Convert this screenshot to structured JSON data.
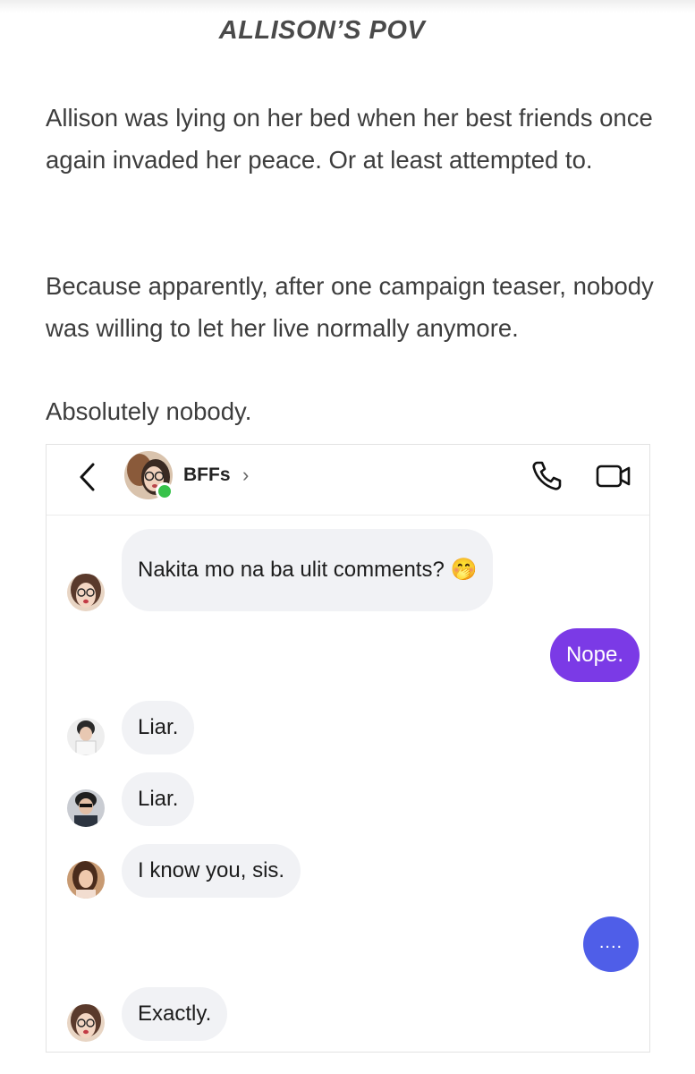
{
  "story": {
    "chapter_title": "ALLISON’S POV",
    "paragraph_1": "Allison was lying on her bed when her best friends once again invaded her peace. Or at least attempted to.",
    "paragraph_2": "Because apparently, after one campaign teaser, nobody was willing to let her live normally anymore.",
    "paragraph_3": "Absolutely nobody."
  },
  "chat": {
    "header": {
      "group_name": "BFFs",
      "chevron": "›",
      "back_icon": "chevron-left-icon",
      "call_icon": "phone-icon",
      "video_icon": "video-camera-icon",
      "online_color": "#37c24a"
    },
    "messages": [
      {
        "sender": "friend",
        "text": "Nakita mo na ba ulit comments? 🤭"
      },
      {
        "sender": "me",
        "text": "Nope."
      },
      {
        "sender": "friend",
        "text": "Liar."
      },
      {
        "sender": "friend",
        "text": "Liar."
      },
      {
        "sender": "friend",
        "text": "I know you, sis."
      },
      {
        "sender": "me",
        "text": "...."
      },
      {
        "sender": "friend",
        "text": "Exactly."
      }
    ],
    "colors": {
      "my_bubble": "#7b3ae6",
      "typing_bubble": "#4f5ee8",
      "friend_bubble": "#f1f2f5"
    }
  }
}
